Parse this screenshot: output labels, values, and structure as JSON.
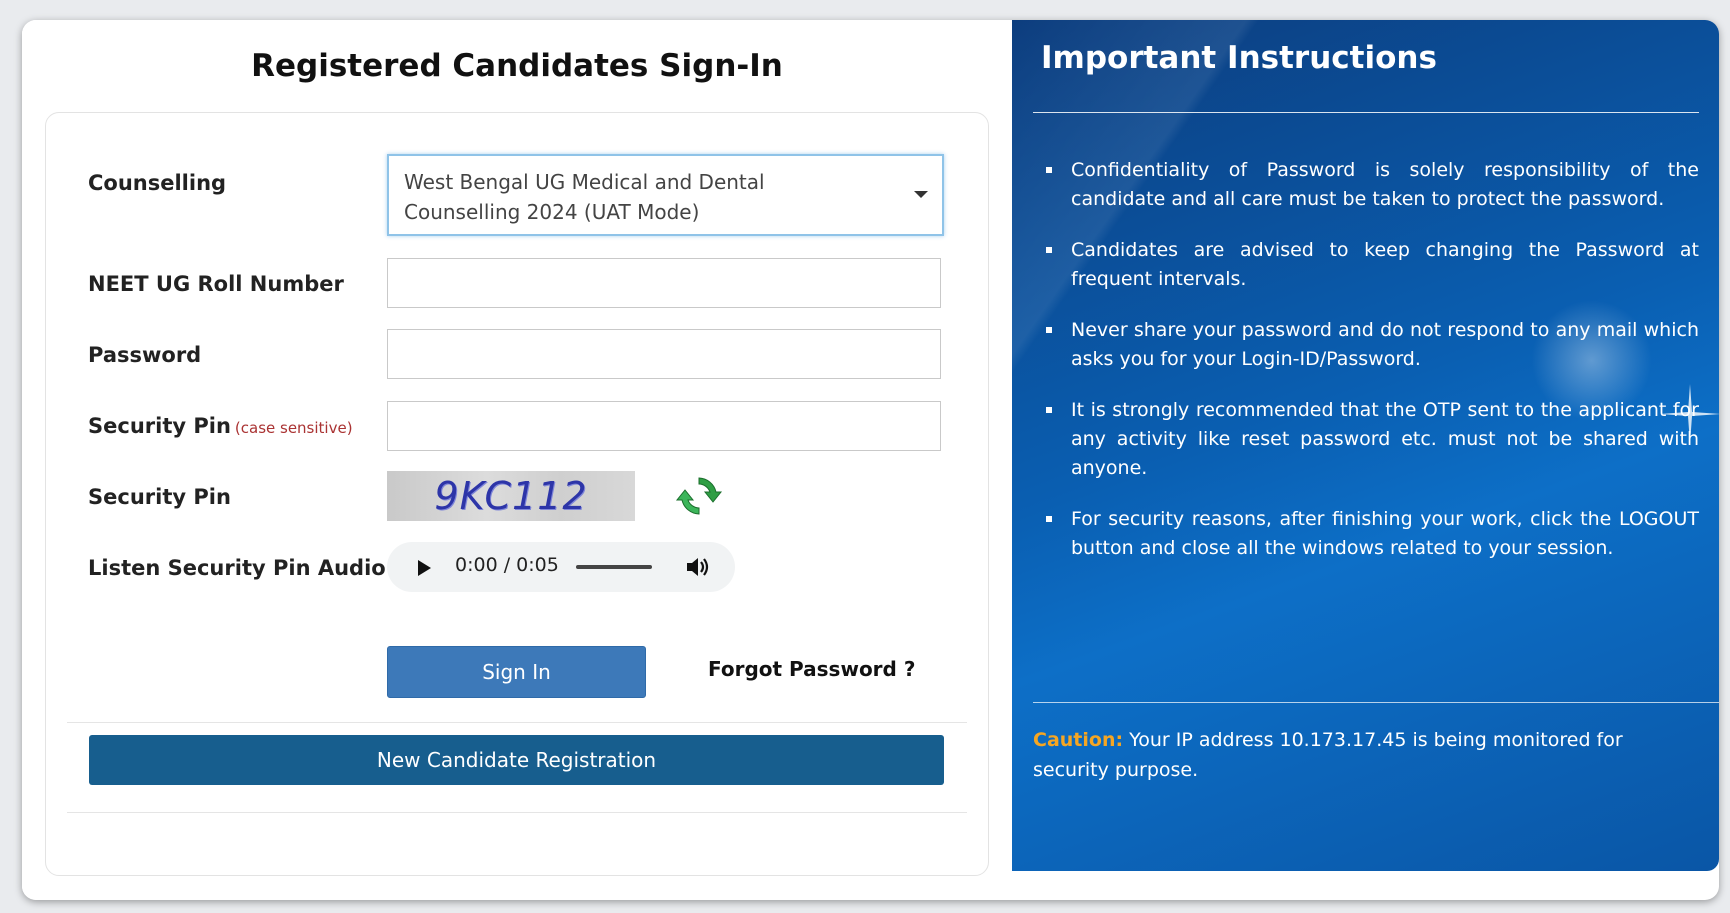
{
  "login": {
    "title": "Registered Candidates Sign-In",
    "counselling_label": "Counselling",
    "counselling_value": "West Bengal UG Medical and Dental Counselling 2024 (UAT Mode)",
    "roll_label": "NEET UG Roll Number",
    "password_label": "Password",
    "security_pin_label": "Security Pin",
    "case_sensitive_note": "(case sensitive)",
    "security_pin_image_label": "Security Pin",
    "captcha_text": "9KC112",
    "audio_label": "Listen Security Pin Audio",
    "audio_time": "0:00 / 0:05",
    "signin_label": "Sign In",
    "forgot_label": "Forgot Password ?",
    "register_label": "New Candidate Registration"
  },
  "instructions": {
    "title": "Important Instructions",
    "items": [
      "Confidentiality of Password is solely responsibility of the candidate and all care must be taken to protect the password.",
      "Candidates are advised to keep changing the Password at frequent intervals.",
      "Never share your password and do not respond to any mail which asks you for your Login-ID/Password.",
      "It is strongly recommended that the OTP sent to the applicant for any activity like reset password etc. must not be shared with anyone.",
      "For security reasons, after finishing your work, click the LOGOUT button and close all the windows related to your session."
    ],
    "caution_label": "Caution:",
    "caution_text": " Your IP address 10.173.17.45 is being monitored for security purpose."
  },
  "colors": {
    "panel_blue": "#0a64b8",
    "signin_button": "#3d79b9",
    "register_button": "#175e8e",
    "caution_orange": "#f5a623"
  },
  "icons": [
    "refresh-icon",
    "play-icon",
    "volume-icon",
    "dropdown-arrow-icon"
  ]
}
